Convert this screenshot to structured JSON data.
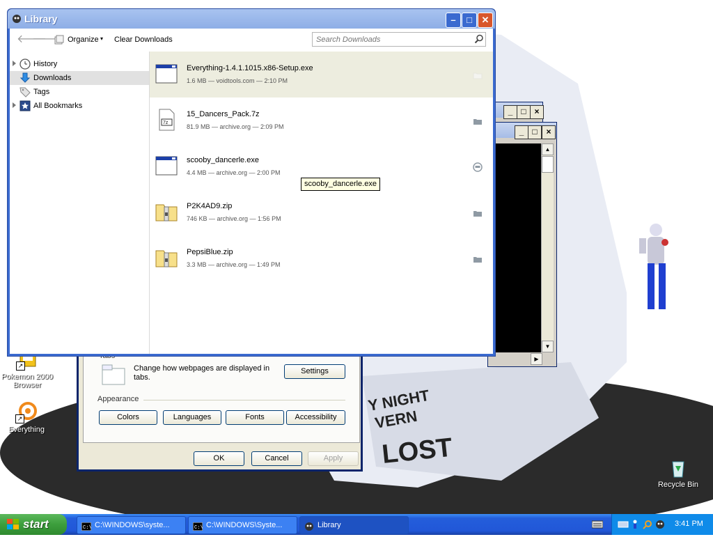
{
  "desktop": {
    "icons": [
      {
        "label": "Pokemon 2000 Browser"
      },
      {
        "label": "Everything"
      },
      {
        "label": "Recycle Bin"
      }
    ],
    "wallpaper_text": [
      "Y NIGHT",
      "VERN",
      "LOST"
    ]
  },
  "options_dialog": {
    "tabs_section_label": "Tabs",
    "tabs_description": "Change how webpages are displayed in tabs.",
    "settings_button": "Settings",
    "appearance_label": "Appearance",
    "appearance_buttons": [
      "Colors",
      "Languages",
      "Fonts",
      "Accessibility"
    ],
    "ok_button": "OK",
    "cancel_button": "Cancel",
    "apply_button": "Apply"
  },
  "library": {
    "title": "Library",
    "toolbar": {
      "organize_label": "Organize",
      "clear_downloads_label": "Clear Downloads",
      "search_placeholder": "Search Downloads"
    },
    "sidebar": [
      {
        "label": "History",
        "icon": "clock-icon",
        "expandable": true,
        "selected": false
      },
      {
        "label": "Downloads",
        "icon": "download-arrow-icon",
        "expandable": false,
        "selected": true
      },
      {
        "label": "Tags",
        "icon": "tag-icon",
        "expandable": false,
        "selected": false
      },
      {
        "label": "All Bookmarks",
        "icon": "bookmarks-star-icon",
        "expandable": true,
        "selected": false
      }
    ],
    "downloads": [
      {
        "name": "Everything-1.4.1.1015.x86-Setup.exe",
        "meta": "1.6 MB — voidtools.com — 2:10 PM",
        "icon": "exe-icon",
        "selected": true
      },
      {
        "name": "15_Dancers_Pack.7z",
        "meta": "81.9 MB — archive.org — 2:09 PM",
        "icon": "7z-icon",
        "selected": false
      },
      {
        "name": "scooby_dancerle.exe",
        "meta": "4.4 MB — archive.org — 2:00 PM",
        "icon": "exe-icon",
        "selected": false
      },
      {
        "name": "P2K4AD9.zip",
        "meta": "746 KB — archive.org — 1:56 PM",
        "icon": "zip-icon",
        "selected": false
      },
      {
        "name": "PepsiBlue.zip",
        "meta": "3.3 MB — archive.org — 1:49 PM",
        "icon": "zip-icon",
        "selected": false
      }
    ],
    "tooltip": "scooby_dancerle.exe"
  },
  "taskbar": {
    "start_label": "start",
    "tasks": [
      {
        "label": "C:\\WINDOWS\\syste...",
        "icon": "console-icon"
      },
      {
        "label": "C:\\WINDOWS\\Syste...",
        "icon": "console-icon"
      },
      {
        "label": "Library",
        "icon": "firefox-icon"
      }
    ],
    "clock": "3:41 PM"
  }
}
